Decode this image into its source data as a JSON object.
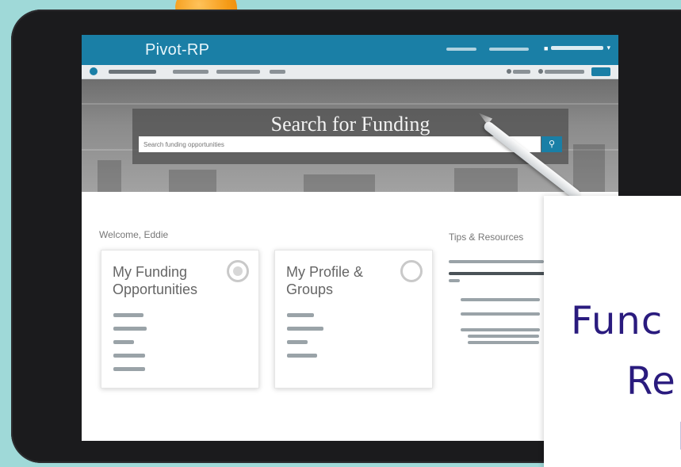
{
  "brand": {
    "name": "Pivot-RP"
  },
  "search": {
    "title": "Search for Funding",
    "placeholder": "Search funding opportunities",
    "button_icon": "search-icon"
  },
  "welcome": "Welcome, Eddie",
  "cards": [
    {
      "title": "My Funding Opportunities",
      "icon": "tracking-icon",
      "link_count": 5
    },
    {
      "title": "My Profile & Groups",
      "icon": "profile-icon",
      "link_count": 4
    }
  ],
  "tips": {
    "title": "Tips & Resources"
  },
  "promo": {
    "lines": [
      "Func",
      "Re",
      "I"
    ]
  },
  "colors": {
    "brand_blue": "#1a7fa6",
    "promo_text": "#2a1b7e",
    "accent_orange": "#f59b17",
    "background": "#9fd9d8"
  }
}
